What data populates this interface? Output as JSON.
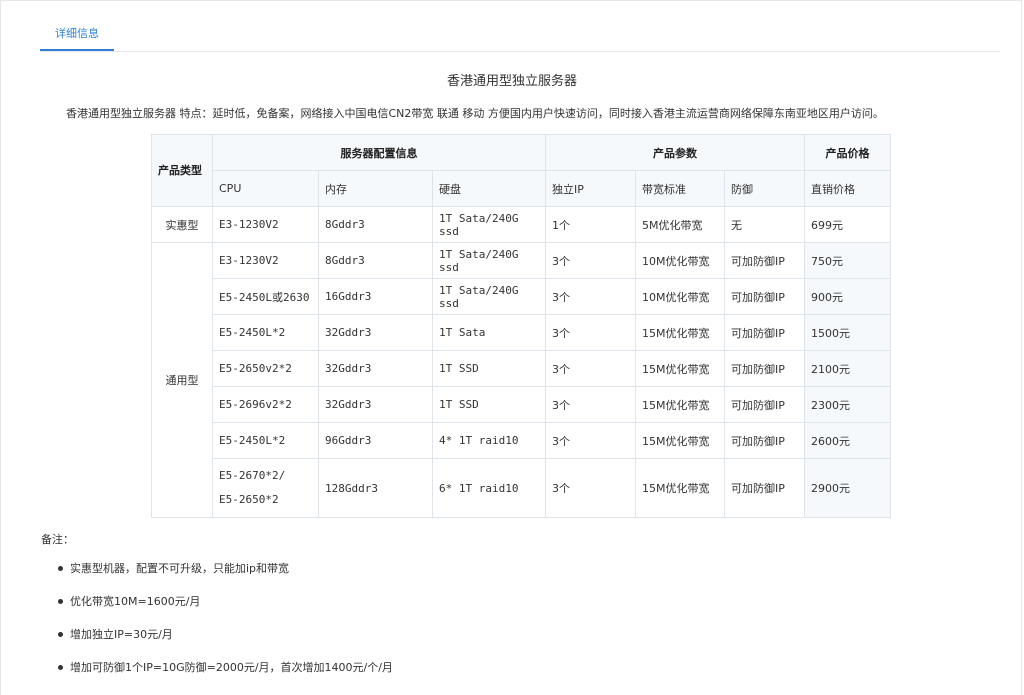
{
  "tabs": [
    {
      "label": "详细信息"
    }
  ],
  "title": "香港通用型独立服务器",
  "description": "香港通用型独立服务器 特点：延时低，免备案，网络接入中国电信CN2带宽 联通 移动 方便国内用户快速访问，同时接入香港主流运营商网络保障东南亚地区用户访问。",
  "table": {
    "group_headers": {
      "product_type": "产品类型",
      "config": "服务器配置信息",
      "params": "产品参数",
      "price": "产品价格"
    },
    "column_headers": [
      "CPU",
      "内存",
      "硬盘",
      "独立IP",
      "带宽标准",
      "防御",
      "直销价格"
    ],
    "categories": [
      "实惠型",
      "通用型"
    ],
    "rows": [
      {
        "cpu": "E3-1230V2",
        "memory": "8Gddr3",
        "disk": "1T Sata/240G ssd",
        "ip": "1个",
        "bandwidth": "5M优化带宽",
        "defense": "无",
        "price": "699元"
      },
      {
        "cpu": "E3-1230V2",
        "memory": "8Gddr3",
        "disk": "1T Sata/240G ssd",
        "ip": "3个",
        "bandwidth": "10M优化带宽",
        "defense": "可加防御IP",
        "price": "750元"
      },
      {
        "cpu": "E5-2450L或2630",
        "memory": "16Gddr3",
        "disk": "1T Sata/240G ssd",
        "ip": "3个",
        "bandwidth": "10M优化带宽",
        "defense": "可加防御IP",
        "price": "900元"
      },
      {
        "cpu": "E5-2450L*2",
        "memory": "32Gddr3",
        "disk": "1T Sata",
        "ip": "3个",
        "bandwidth": "15M优化带宽",
        "defense": "可加防御IP",
        "price": "1500元"
      },
      {
        "cpu": "E5-2650v2*2",
        "memory": "32Gddr3",
        "disk": "1T SSD",
        "ip": "3个",
        "bandwidth": "15M优化带宽",
        "defense": "可加防御IP",
        "price": "2100元"
      },
      {
        "cpu": "E5-2696v2*2",
        "memory": "32Gddr3",
        "disk": "1T SSD",
        "ip": "3个",
        "bandwidth": "15M优化带宽",
        "defense": "可加防御IP",
        "price": "2300元"
      },
      {
        "cpu": "E5-2450L*2",
        "memory": "96Gddr3",
        "disk": "4* 1T raid10",
        "ip": "3个",
        "bandwidth": "15M优化带宽",
        "defense": "可加防御IP",
        "price": "2600元"
      },
      {
        "cpu": "E5-2670*2/",
        "cpu_line2": "E5-2650*2",
        "memory": "128Gddr3",
        "disk": "6* 1T raid10",
        "ip": "3个",
        "bandwidth": "15M优化带宽",
        "defense": "可加防御IP",
        "price": "2900元"
      }
    ]
  },
  "notes": {
    "label": "备注：",
    "items": [
      "实惠型机器，配置不可升级，只能加ip和带宽",
      "优化带宽10M=1600元/月",
      "增加独立IP=30元/月",
      "增加可防御1个IP=10G防御=2000元/月，首次增加1400元/个/月"
    ]
  },
  "colors": {
    "accent": "#2f7fd6",
    "header_bg": "#f6f9fc",
    "border": "#dfe3ea"
  }
}
